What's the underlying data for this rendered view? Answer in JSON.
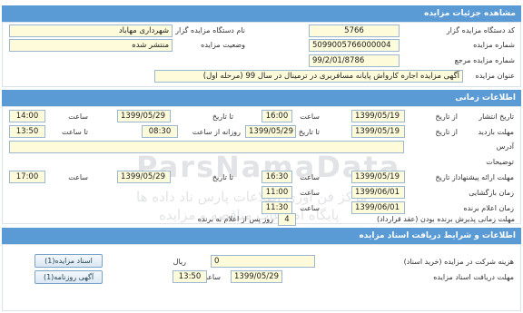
{
  "details": {
    "title": "مشاهده جزئیات مزایده",
    "auctioneer_code_label": "کد دستگاه مزایده گزار",
    "auctioneer_code": "5766",
    "auctioneer_name_label": "نام دستگاه مزایده گزار",
    "auctioneer_name": "شهرداری مهاباد",
    "auction_number_label": "شماره مزایده",
    "auction_number": "5099005766000004",
    "status_label": "وضعیت مزایده",
    "status": "منتشر شده",
    "reference_number_label": "شماره مزایده مرجع",
    "reference_number": "99/2/01/8786",
    "subject_label": "عنوان مزایده",
    "subject": "آگهی مزایده اجاره کارواش پایانه مسافربری در ترمینال در سال 99 (مرحله اول)"
  },
  "timing": {
    "title": "اطلاعات زمانی",
    "publish_label": "تاریخ انتشار",
    "publish_from_label": "از تاریخ",
    "publish_from_date": "1399/05/19",
    "publish_from_time_label": "ساعت",
    "publish_from_time": "16:00",
    "publish_to_label": "تا تاریخ",
    "publish_to_date": "1399/05/29",
    "publish_to_time_label": "ساعت",
    "publish_to_time": "14:00",
    "visit_label": "مهلت بازدید",
    "visit_from_label": "از تاریخ",
    "visit_from_date": "1399/05/19",
    "visit_to_label": "تا تاریخ",
    "visit_to_date": "1399/05/29",
    "visit_daily_label": "روزانه از ساعت",
    "visit_daily_from": "08:30",
    "visit_daily_to_label": "تا ساعت",
    "visit_daily_to": "13:50",
    "address_label": "آدرس",
    "address": "",
    "notes_label": "توضیحات",
    "notes": "",
    "offer_label": "مهلت ارائه پیشنهاد",
    "offer_from_label": "از تاریخ",
    "offer_from_date": "1399/05/19",
    "offer_from_time_label": "ساعت",
    "offer_from_time": "16:30",
    "offer_to_label": "تا تاریخ",
    "offer_to_date": "1399/05/29",
    "offer_to_time_label": "ساعت",
    "offer_to_time": "17:00",
    "opening_label": "زمان بازگشایی",
    "opening_date": "1399/06/01",
    "opening_time_label": "ساعت",
    "opening_time": "11:00",
    "winner_label": "زمان اعلام برنده",
    "winner_date": "1399/06/01",
    "winner_time_label": "ساعت",
    "winner_time": "11:30",
    "contract_label": "مهلت زمانی پذیرش برنده بودن (عقد قرارداد)",
    "contract_days": "4",
    "contract_suffix": "روز پس از اعلام به برنده"
  },
  "documents": {
    "title": "اطلاعات و شرایط دریافت اسناد مزایده",
    "fee_label": "هزینه شرکت در مزایده (خرید اسناد)",
    "fee_value": "0",
    "fee_unit": "ریال",
    "deadline_label": "مهلت دریافت اسناد مزایده",
    "deadline_date": "1399/05/29",
    "deadline_time_label": "ساعت",
    "deadline_time": "13:50",
    "doc_button": "اسناد مزایده(1)",
    "newspaper_button": "آگهی روزنامه(1)"
  },
  "watermark": {
    "brand": "ParsNamaData",
    "line1": "مرکز فن آوری اطلاعات پارس ناد داده ها",
    "line2": "پایگاه اطلاعات مناقصه و مزایده"
  }
}
